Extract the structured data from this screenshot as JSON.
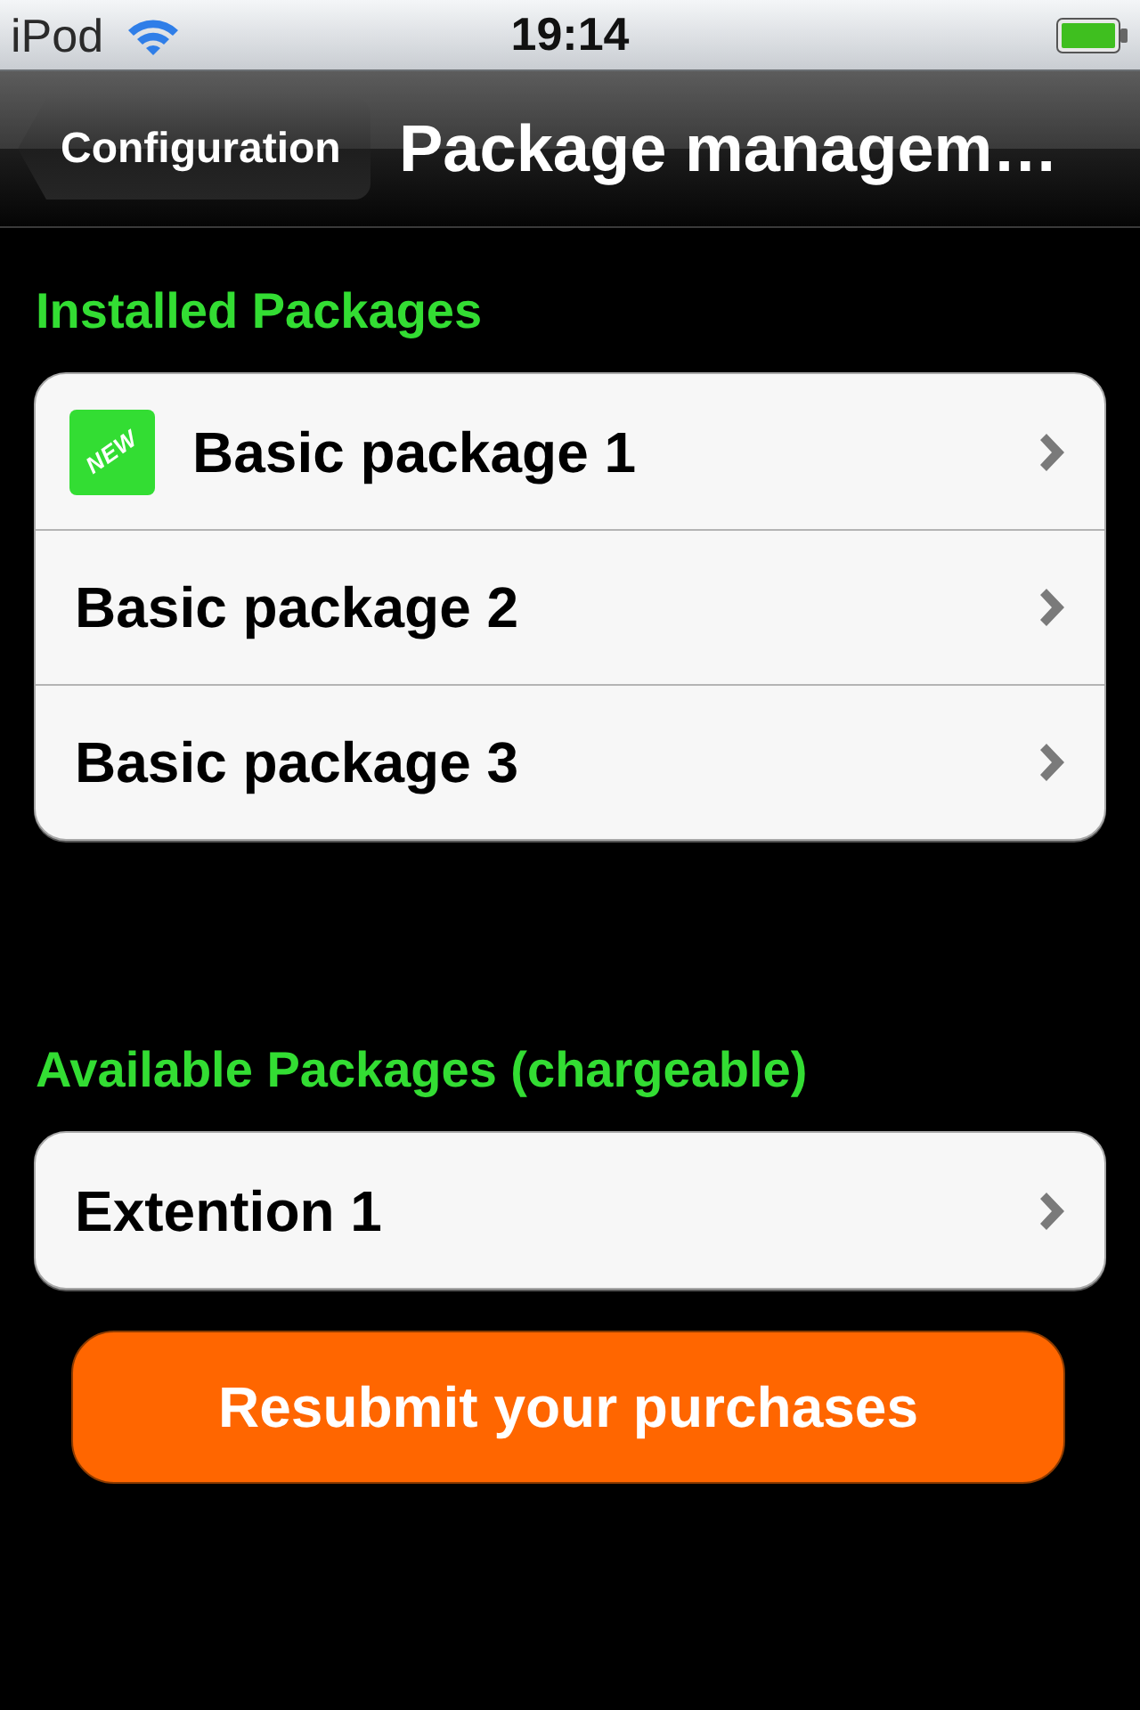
{
  "status_bar": {
    "carrier": "iPod",
    "time": "19:14"
  },
  "nav_bar": {
    "back_button": "Configuration",
    "title": "Package managem…"
  },
  "sections": [
    {
      "header": "Installed Packages",
      "items": [
        {
          "label": "Basic package 1",
          "badge": "NEW"
        },
        {
          "label": "Basic package 2"
        },
        {
          "label": "Basic package 3"
        }
      ]
    },
    {
      "header": "Available Packages (chargeable)",
      "items": [
        {
          "label": "Extention 1"
        }
      ]
    }
  ],
  "action_button": "Resubmit your purchases"
}
